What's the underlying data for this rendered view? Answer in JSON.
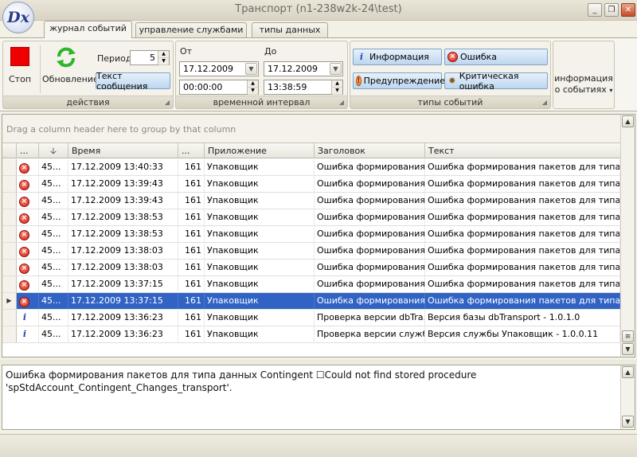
{
  "app": {
    "logo_text": "Dx",
    "title": "Транспорт (n1-238w2k-24\\test)"
  },
  "window_buttons": {
    "minimize": "_",
    "restore": "❐",
    "close": "✕"
  },
  "tabs": [
    {
      "label": "журнал событий",
      "active": true
    },
    {
      "label": "управление службами",
      "active": false
    },
    {
      "label": "типы данных",
      "active": false
    }
  ],
  "ribbon": {
    "actions": {
      "label": "действия",
      "stop_label": "Стоп",
      "refresh_label": "Обновление",
      "period_label": "Период",
      "period_value": "5",
      "message_text_label": "Текст сообщения"
    },
    "time_interval": {
      "label": "временной интервал",
      "from_label": "От",
      "to_label": "До",
      "from_date": "17.12.2009",
      "to_date": "17.12.2009",
      "from_time": "00:00:00",
      "to_time": "13:38:59"
    },
    "event_types": {
      "label": "типы событий",
      "info": "Информация",
      "error": "Ошибка",
      "warning": "Предупреждение",
      "critical": "Критическая ошибка"
    },
    "event_info": {
      "line1": "информация",
      "line2": "о событиях"
    }
  },
  "grid": {
    "group_hint": "Drag a column header here to group by that column",
    "headers": {
      "c1": "...",
      "c2": "",
      "time": "Время",
      "c4": "...",
      "app": "Приложение",
      "title": "Заголовок",
      "text": "Текст"
    },
    "rows": [
      {
        "icon": "error",
        "id": "45...",
        "time": "17.12.2009 13:40:33",
        "num": "161",
        "app": "Упаковщик",
        "title": "Ошибка формирования ...",
        "text": "Ошибка формирования пакетов для типа данных",
        "selected": false
      },
      {
        "icon": "error",
        "id": "45...",
        "time": "17.12.2009 13:39:43",
        "num": "161",
        "app": "Упаковщик",
        "title": "Ошибка формирования ...",
        "text": "Ошибка формирования пакетов для типа данных",
        "selected": false
      },
      {
        "icon": "error",
        "id": "45...",
        "time": "17.12.2009 13:39:43",
        "num": "161",
        "app": "Упаковщик",
        "title": "Ошибка формирования ...",
        "text": "Ошибка формирования пакетов для типа данных",
        "selected": false
      },
      {
        "icon": "error",
        "id": "45...",
        "time": "17.12.2009 13:38:53",
        "num": "161",
        "app": "Упаковщик",
        "title": "Ошибка формирования ...",
        "text": "Ошибка формирования пакетов для типа данных",
        "selected": false
      },
      {
        "icon": "error",
        "id": "45...",
        "time": "17.12.2009 13:38:53",
        "num": "161",
        "app": "Упаковщик",
        "title": "Ошибка формирования ...",
        "text": "Ошибка формирования пакетов для типа данных",
        "selected": false
      },
      {
        "icon": "error",
        "id": "45...",
        "time": "17.12.2009 13:38:03",
        "num": "161",
        "app": "Упаковщик",
        "title": "Ошибка формирования ...",
        "text": "Ошибка формирования пакетов для типа данных",
        "selected": false
      },
      {
        "icon": "error",
        "id": "45...",
        "time": "17.12.2009 13:38:03",
        "num": "161",
        "app": "Упаковщик",
        "title": "Ошибка формирования ...",
        "text": "Ошибка формирования пакетов для типа данных",
        "selected": false
      },
      {
        "icon": "error",
        "id": "45...",
        "time": "17.12.2009 13:37:15",
        "num": "161",
        "app": "Упаковщик",
        "title": "Ошибка формирования ...",
        "text": "Ошибка формирования пакетов для типа данных",
        "selected": false
      },
      {
        "icon": "error",
        "id": "45...",
        "time": "17.12.2009 13:37:15",
        "num": "161",
        "app": "Упаковщик",
        "title": "Ошибка формирования ...",
        "text": "Ошибка формирования пакетов для типа данных",
        "selected": true
      },
      {
        "icon": "info",
        "id": "45...",
        "time": "17.12.2009 13:36:23",
        "num": "161",
        "app": "Упаковщик",
        "title": "Проверка версии dbTra...",
        "text": "Версия базы dbTransport - 1.0.1.0",
        "selected": false
      },
      {
        "icon": "info",
        "id": "45...",
        "time": "17.12.2009 13:36:23",
        "num": "161",
        "app": "Упаковщик",
        "title": "Проверка версии службы",
        "text": "Версия службы Упаковщик - 1.0.0.11",
        "selected": false
      }
    ]
  },
  "detail": {
    "message": "Ошибка формирования пакетов для типа данных Contingent ☐Could not find stored procedure 'spStdAccount_Contingent_Changes_transport'."
  },
  "colors": {
    "selection": "#3163c5",
    "error": "#d11d10",
    "stop": "#ee0000",
    "refresh": "#2fb52a"
  }
}
